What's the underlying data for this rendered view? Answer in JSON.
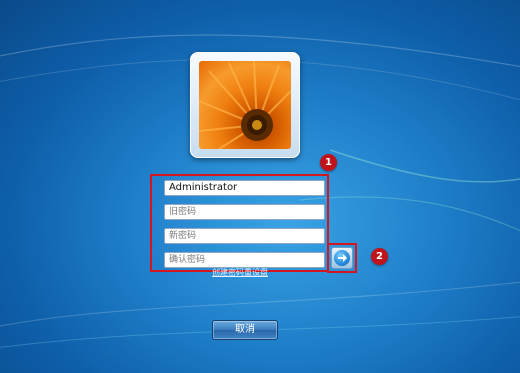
{
  "login": {
    "username": "Administrator",
    "old_password_placeholder": "旧密码",
    "new_password_placeholder": "新密码",
    "confirm_password_placeholder": "确认密码",
    "reset_link": "创建密码重设盘",
    "cancel_label": "取消"
  },
  "annotations": {
    "badge1": "1",
    "badge2": "2",
    "highlight_color": "#d4161f"
  },
  "icons": {
    "avatar": "orange-flower-icon",
    "submit": "right-arrow-icon"
  },
  "colors": {
    "desktop_blue": "#1f7fc9",
    "annotation_red": "#c0141c"
  }
}
